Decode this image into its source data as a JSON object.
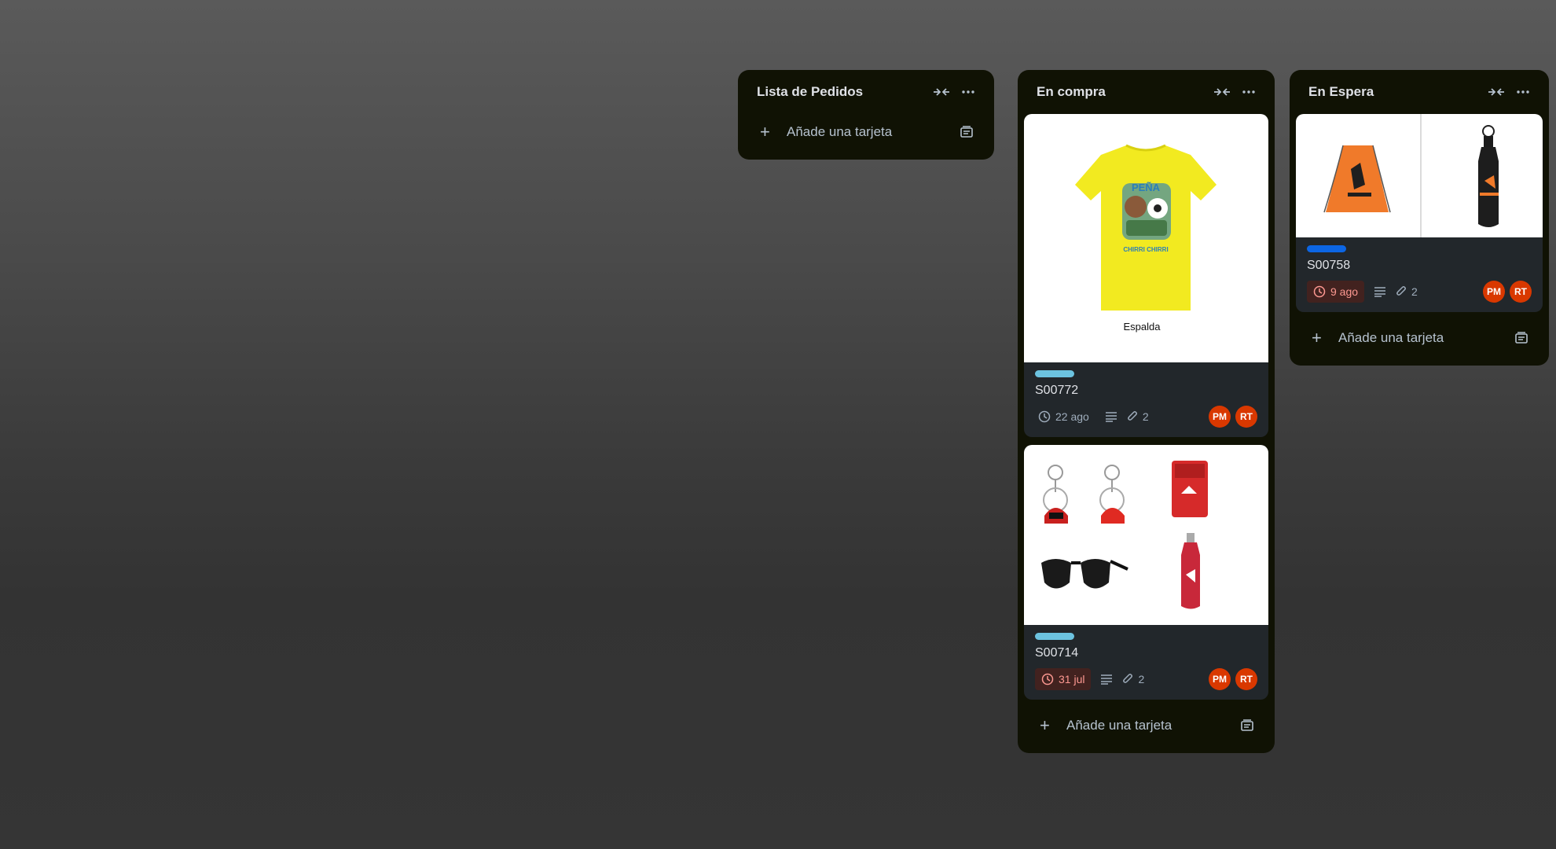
{
  "lists": [
    {
      "title": "Lista de Pedidos",
      "add_card_label": "Añade una tarjeta"
    },
    {
      "title": "En compra",
      "add_card_label": "Añade una tarjeta",
      "cards": [
        {
          "cover_caption": "Espalda",
          "shirt_text": "PEÑA",
          "shirt_text2": "CHIRRI CHIRRI",
          "label_color": "#6cc3e0",
          "title": "S00772",
          "due": "22 ago",
          "attachments": "2",
          "members": [
            "PM",
            "RT"
          ]
        },
        {
          "label_color": "#6cc3e0",
          "title": "S00714",
          "due": "31 jul",
          "attachments": "2",
          "members": [
            "PM",
            "RT"
          ]
        }
      ]
    },
    {
      "title": "En Espera",
      "add_card_label": "Añade una tarjeta",
      "cards": [
        {
          "label_color": "#0c66e4",
          "title": "S00758",
          "due": "9 ago",
          "attachments": "2",
          "members": [
            "PM",
            "RT"
          ]
        }
      ]
    }
  ],
  "colors": {
    "list_bg": "#101204",
    "card_bg": "#22272b",
    "avatar_bg": "#d93800",
    "overdue_bg": "#42221f",
    "overdue_text": "#fd9891"
  }
}
